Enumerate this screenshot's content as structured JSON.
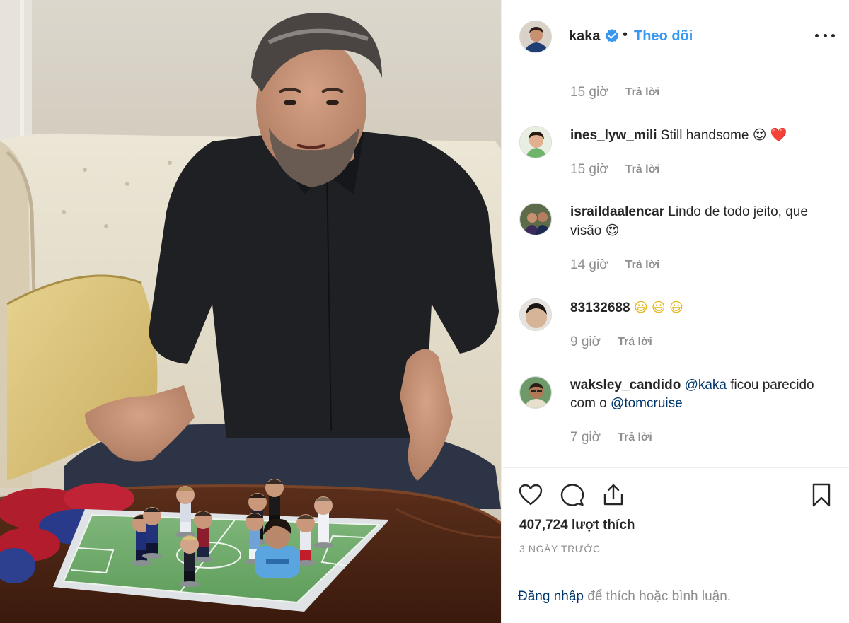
{
  "post": {
    "username": "kaka",
    "follow_label": "Theo dõi",
    "separator": "•"
  },
  "comments": [
    {
      "time": "15 giờ",
      "reply": "Trả lời"
    },
    {
      "user": "ines_lyw_mili",
      "text": "Still handsome",
      "emojis": [
        "😍",
        "❤️"
      ],
      "time": "15 giờ",
      "reply": "Trả lời"
    },
    {
      "user": "israildaalencar",
      "text": "Lindo de todo jeito, que visão",
      "emojis": [
        "😍"
      ],
      "time": "14 giờ",
      "reply": "Trả lời"
    },
    {
      "user": "83132688",
      "text": "",
      "emojis": [
        "😃",
        "😃",
        "😃"
      ],
      "time": "9 giờ",
      "reply": "Trả lời"
    },
    {
      "user": "waksley_candido",
      "mention1": "@kaka",
      "text_mid": "ficou parecido com o",
      "mention2": "@tomcruise",
      "time": "7 giờ",
      "reply": "Trả lời"
    }
  ],
  "engagement": {
    "likes": "407,724 lượt thích",
    "posted_ago": "3 NGÀY TRƯỚC"
  },
  "login_prompt": {
    "link": "Đăng nhập",
    "rest": " để thích hoặc bình luận."
  },
  "colors": {
    "accent": "#3897f0",
    "link_dark": "#003569",
    "muted": "#8e8e8e",
    "text": "#262626",
    "divider": "#efefef",
    "heart": "#ed4956"
  },
  "icons": [
    "verified-badge-icon",
    "more-options-icon",
    "like-heart-icon",
    "comment-bubble-icon",
    "share-icon",
    "save-bookmark-icon"
  ]
}
